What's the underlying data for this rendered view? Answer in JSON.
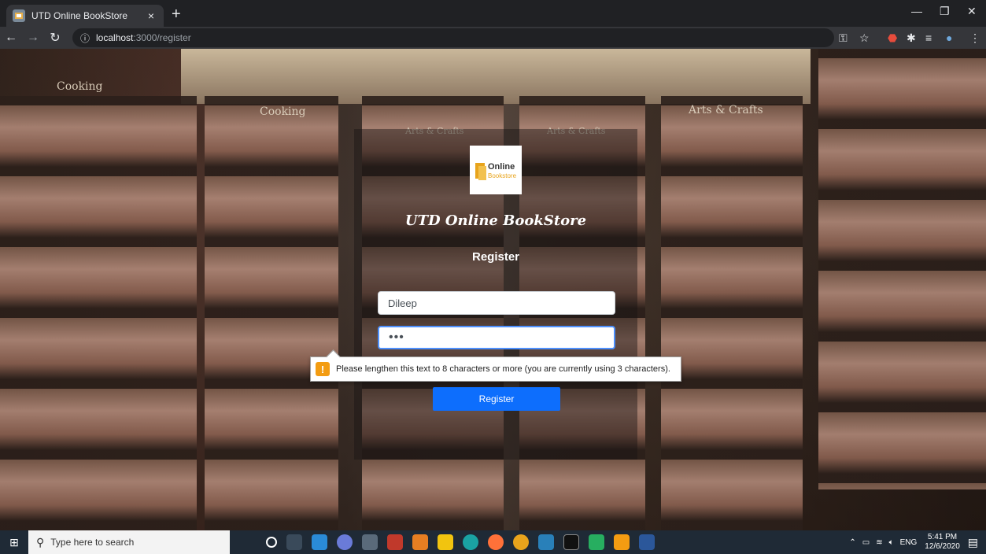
{
  "browser": {
    "tab_title": "UTD Online BookStore",
    "url_host": "localhost",
    "url_path": ":3000/register"
  },
  "background": {
    "signs": [
      "Cooking",
      "Cooking",
      "Arts & Crafts",
      "Arts & Crafts",
      "Arts & Crafts"
    ]
  },
  "form": {
    "brand": "UTD Online BookStore",
    "logo_text_1": "Online",
    "logo_text_2": "Bookstore",
    "heading": "Register",
    "username_value": "Dileep",
    "password_value": "•••",
    "submit_label": "Register",
    "validation_message": "Please lengthen this text to 8 characters or more (you are currently using 3 characters)."
  },
  "taskbar": {
    "search_placeholder": "Type here to search",
    "tray_lang": "ENG",
    "time": "5:41 PM",
    "date": "12/6/2020"
  }
}
